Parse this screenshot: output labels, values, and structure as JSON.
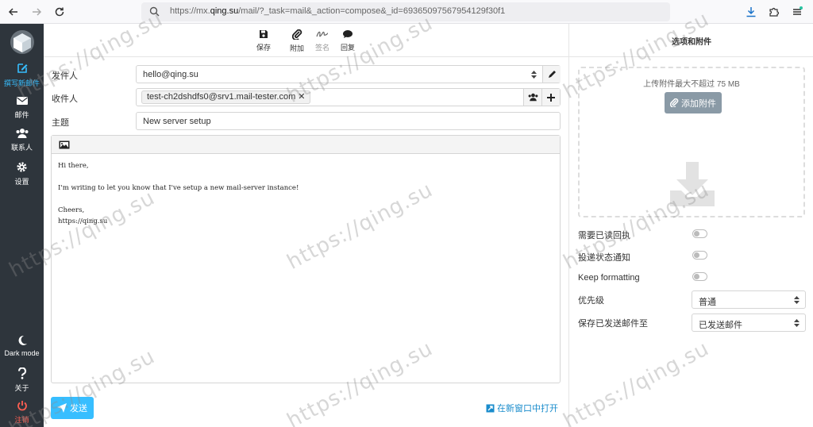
{
  "browser": {
    "url_prefix": "https://mx.",
    "url_domain": "qing.su",
    "url_suffix": "/mail/?_task=mail&_action=compose&_id=69365097567954129f30f1"
  },
  "sidebar": {
    "items": [
      {
        "label": "撰写新邮件",
        "icon": "pencil-square-icon"
      },
      {
        "label": "邮件",
        "icon": "envelope-icon"
      },
      {
        "label": "联系人",
        "icon": "users-icon"
      },
      {
        "label": "设置",
        "icon": "gear-icon"
      }
    ],
    "bottom": [
      {
        "label": "Dark mode",
        "icon": "moon-icon"
      },
      {
        "label": "关于",
        "icon": "question-icon"
      },
      {
        "label": "注销",
        "icon": "power-icon"
      }
    ]
  },
  "toolbar": {
    "save": "保存",
    "attach": "附加",
    "signature": "签名",
    "responses": "回复"
  },
  "compose": {
    "from_label": "发件人",
    "from_value": "hello@qing.su",
    "to_label": "收件人",
    "to_value": "test-ch2dshdfs0@srv1.mail-tester.com",
    "subject_label": "主题",
    "subject_value": "New server setup",
    "body": "Hi there,\n\nI'm writing to let you know that I've setup a new mail-server instance!\n\nCheers,\nhttps://qing.su",
    "send_label": "发送",
    "popout_label": "在新窗口中打开"
  },
  "options": {
    "title": "选项和附件",
    "upload_limit": "上传附件最大不超过 75 MB",
    "add_attachment": "添加附件",
    "read_receipt": "需要已读回执",
    "delivery_status": "投递状态通知",
    "keep_formatting": "Keep formatting",
    "priority_label": "优先级",
    "priority_value": "普通",
    "save_sent_label": "保存已发送邮件至",
    "save_sent_value": "已发送邮件"
  },
  "watermark": "https://qing.su",
  "colors": {
    "accent": "#37beff",
    "sidebar_bg": "#2e353c",
    "logout": "#ff5f52"
  }
}
